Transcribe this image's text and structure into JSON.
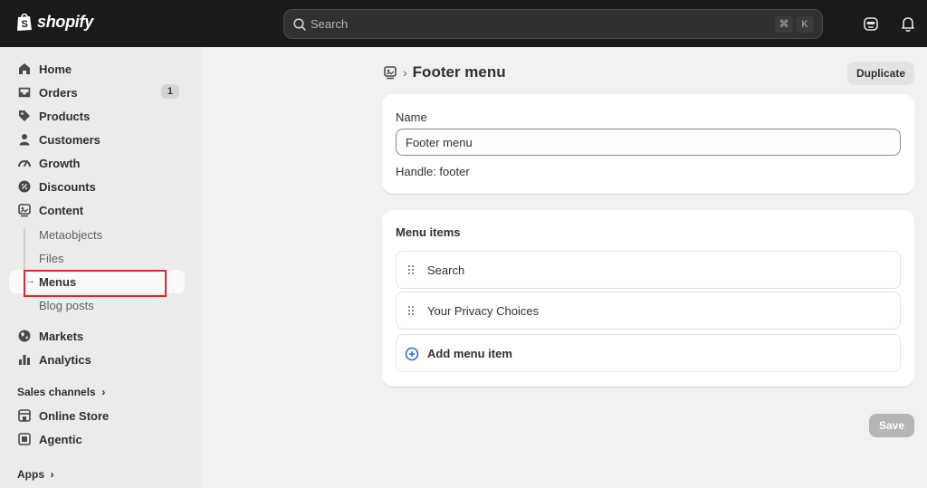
{
  "topbar": {
    "logo_text": "shopify",
    "search_placeholder": "Search",
    "shortcut_key1": "⌘",
    "shortcut_key2": "K"
  },
  "sidebar": {
    "items": [
      {
        "label": "Home",
        "icon": "home-icon"
      },
      {
        "label": "Orders",
        "icon": "inbox-icon",
        "badge": "1"
      },
      {
        "label": "Products",
        "icon": "tag-icon"
      },
      {
        "label": "Customers",
        "icon": "person-icon"
      },
      {
        "label": "Growth",
        "icon": "gauge-icon"
      },
      {
        "label": "Discounts",
        "icon": "discount-icon"
      },
      {
        "label": "Content",
        "icon": "content-icon"
      }
    ],
    "sub_items": [
      {
        "label": "Metaobjects"
      },
      {
        "label": "Files"
      },
      {
        "label": "Menus",
        "active": true
      },
      {
        "label": "Blog posts"
      }
    ],
    "items2": [
      {
        "label": "Markets",
        "icon": "globe-icon"
      },
      {
        "label": "Analytics",
        "icon": "bar-chart-icon"
      }
    ],
    "sales_channels_label": "Sales channels",
    "channels": [
      {
        "label": "Online Store",
        "icon": "store-icon"
      },
      {
        "label": "Agentic",
        "icon": "agent-icon"
      }
    ],
    "apps_label": "Apps"
  },
  "main": {
    "title": "Footer menu",
    "duplicate_label": "Duplicate",
    "name_label": "Name",
    "name_value": "Footer menu",
    "handle_text": "Handle: footer",
    "menu_items_title": "Menu items",
    "menu_items": [
      "Search",
      "Your Privacy Choices"
    ],
    "add_item_label": "Add menu item",
    "save_label": "Save"
  },
  "colors": {
    "topbar": "#1a1a1a",
    "sidebar": "#ebebeb",
    "page": "#f1f1f1",
    "highlight": "#e0282e",
    "accent": "#2c6ecb"
  }
}
